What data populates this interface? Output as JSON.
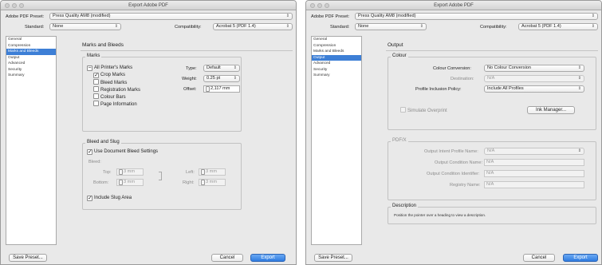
{
  "window1": {
    "title": "Export Adobe PDF",
    "preset_label": "Adobe PDF Preset:",
    "preset_value": "Press Quality AM8 (modified)",
    "standard_label": "Standard:",
    "standard_value": "None",
    "compat_label": "Compatibility:",
    "compat_value": "Acrobat 5 (PDF 1.4)",
    "sidebar": [
      "General",
      "Compression",
      "Marks and Bleeds",
      "Output",
      "Advanced",
      "Security",
      "Summary"
    ],
    "sidebar_active": 2,
    "panel_title": "Marks and Bleeds",
    "marks": {
      "group": "Marks",
      "all": "All Printer's Marks",
      "crop": "Crop Marks",
      "bleed": "Bleed Marks",
      "registration": "Registration Marks",
      "colour_bars": "Colour Bars",
      "page_info": "Page Information",
      "type_label": "Type:",
      "type_value": "Default",
      "weight_label": "Weight:",
      "weight_value": "0.25 pt",
      "offset_label": "Offset:",
      "offset_value": "2,117 mm"
    },
    "bleed": {
      "group": "Bleed and Slug",
      "use_doc": "Use Document Bleed Settings",
      "bleed_label": "Bleed:",
      "top_label": "Top:",
      "top_value": "3 mm",
      "bottom_label": "Bottom:",
      "bottom_value": "3 mm",
      "left_label": "Left:",
      "left_value": "3 mm",
      "right_label": "Right:",
      "right_value": "3 mm",
      "slug": "Include Slug Area"
    },
    "save_preset": "Save Preset...",
    "cancel": "Cancel",
    "export": "Export"
  },
  "window2": {
    "title": "Export Adobe PDF",
    "preset_label": "Adobe PDF Preset:",
    "preset_value": "Press Quality AM8 (modified)",
    "standard_label": "Standard:",
    "standard_value": "None",
    "compat_label": "Compatibility:",
    "compat_value": "Acrobat 5 (PDF 1.4)",
    "sidebar": [
      "General",
      "Compression",
      "Marks and Bleeds",
      "Output",
      "Advanced",
      "Security",
      "Summary"
    ],
    "sidebar_active": 3,
    "panel_title": "Output",
    "colour": {
      "group": "Colour",
      "conversion_label": "Colour Conversion:",
      "conversion_value": "No Colour Conversion",
      "destination_label": "Destination:",
      "destination_value": "N/A",
      "policy_label": "Profile Inclusion Policy:",
      "policy_value": "Include All Profiles",
      "simulate": "Simulate Overprint",
      "ink_manager": "Ink Manager..."
    },
    "pdfx": {
      "group": "PDF/X",
      "intent_label": "Output Intent Profile Name:",
      "intent_value": "N/A",
      "condition_label": "Output Condition Name:",
      "condition_value": "N/A",
      "identifier_label": "Output Condition Identifier:",
      "identifier_value": "N/A",
      "registry_label": "Registry Name:",
      "registry_value": "N/A"
    },
    "description": {
      "group": "Description",
      "text": "Position the pointer over a heading to view a description."
    },
    "save_preset": "Save Preset...",
    "cancel": "Cancel",
    "export": "Export"
  },
  "colors": {
    "accent": "#3d7fd6",
    "window_bg": "#e9e9e9"
  }
}
